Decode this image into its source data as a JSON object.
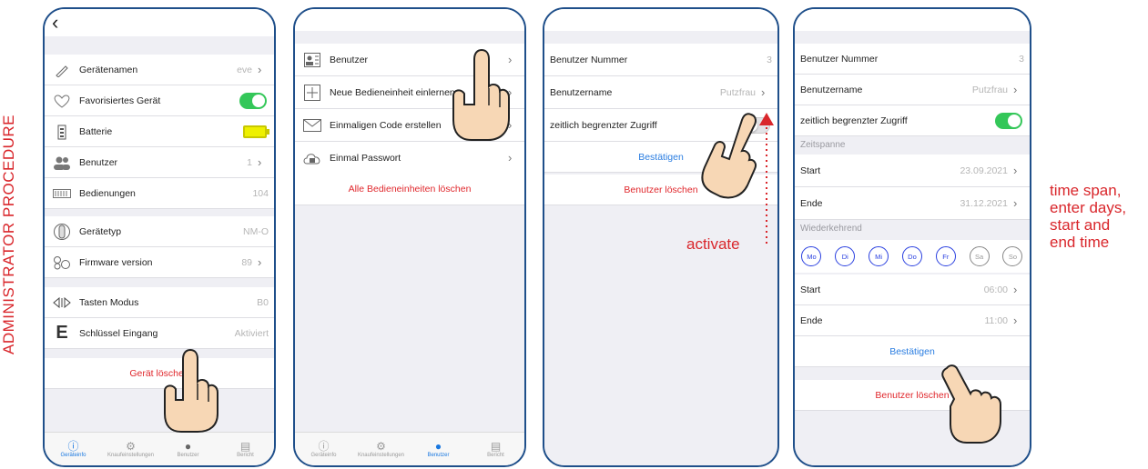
{
  "side_label": "ADMINISTRATOR PROCEDURE",
  "phone1": {
    "rows": [
      {
        "icon": "pencil-icon",
        "label": "Gerätenamen",
        "value": "eve",
        "chevron": true
      },
      {
        "icon": "heart-icon",
        "label": "Favorisiertes Gerät",
        "toggle": "on"
      },
      {
        "icon": "battery-icon",
        "label": "Batterie",
        "battery": true
      },
      {
        "icon": "users-icon",
        "label": "Benutzer",
        "value": "1",
        "chevron": true
      },
      {
        "icon": "counter-icon",
        "label": "Bedienungen",
        "value": "104"
      },
      {
        "icon": "lock-cylinder-icon",
        "label": "Gerätetyp",
        "value": "NM-O"
      },
      {
        "icon": "gears-icon",
        "label": "Firmware version",
        "value": "89",
        "chevron": true
      },
      {
        "icon": "arrows-icon",
        "label": "Tasten Modus",
        "value": "B0"
      },
      {
        "icon": "e-icon",
        "label": "Schlüssel Eingang",
        "value": "Aktiviert"
      }
    ],
    "delete_label": "Gerät löschen",
    "tabs": [
      "Geräteinfo",
      "Knaufeinstellungen",
      "Benutzer",
      "Bericht"
    ],
    "active_tab": 0
  },
  "phone2": {
    "rows": [
      {
        "icon": "user-card-icon",
        "label": "Benutzer"
      },
      {
        "icon": "plus-box-icon",
        "label": "Neue Bedieneinheit einlernen"
      },
      {
        "icon": "envelope-icon",
        "label": "Einmaligen Code erstellen"
      },
      {
        "icon": "cloud-lock-icon",
        "label": "Einmal Passwort"
      }
    ],
    "delete_label": "Alle Bedieneinheiten löschen",
    "tabs": [
      "Geräteinfo",
      "Knaufeinstellungen",
      "Benutzer",
      "Bericht"
    ],
    "active_tab": 2
  },
  "phone3": {
    "number_label": "Benutzer Nummer",
    "number_value": "3",
    "name_label": "Benutzername",
    "name_value": "Putzfrau",
    "access_label": "zeitlich begrenzter Zugriff",
    "confirm_label": "Bestätigen",
    "delete_label": "Benutzer löschen",
    "activate_note": "activate"
  },
  "phone4": {
    "number_label": "Benutzer Nummer",
    "number_value": "3",
    "name_label": "Benutzername",
    "name_value": "Putzfrau",
    "access_label": "zeitlich begrenzter Zugriff",
    "span_title": "Zeitspanne",
    "start_label": "Start",
    "start_date": "23.09.2021",
    "end_label": "Ende",
    "end_date": "31.12.2021",
    "recurring_title": "Wiederkehrend",
    "days": [
      {
        "label": "Mo",
        "on": true
      },
      {
        "label": "Di",
        "on": true
      },
      {
        "label": "Mi",
        "on": true
      },
      {
        "label": "Do",
        "on": true
      },
      {
        "label": "Fr",
        "on": true
      },
      {
        "label": "Sa",
        "on": false
      },
      {
        "label": "So",
        "on": false
      }
    ],
    "time_start_label": "Start",
    "time_start": "06:00",
    "time_end_label": "Ende",
    "time_end": "11:00",
    "confirm_label": "Bestätigen",
    "delete_label": "Benutzer löschen"
  },
  "right_note": [
    "time span,",
    "enter days,",
    "start and",
    "end time"
  ],
  "colors": {
    "frame": "#1f4f8a",
    "accent_red": "#d9262b",
    "toggle_green": "#34c759",
    "link_blue": "#2a7de1"
  }
}
